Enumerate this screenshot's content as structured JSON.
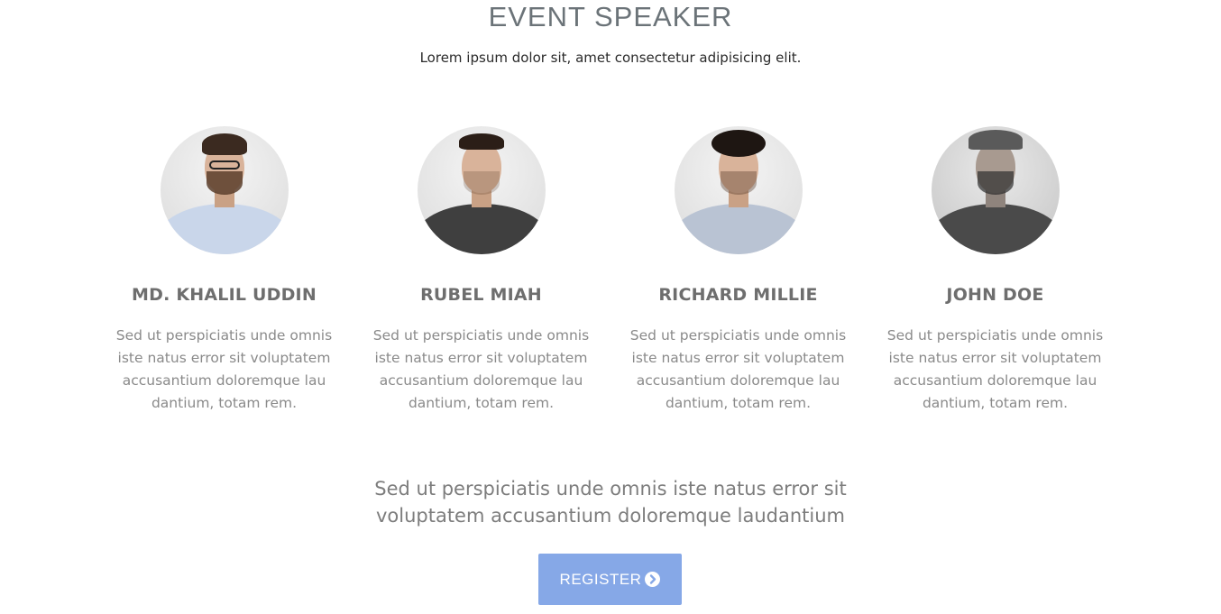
{
  "section": {
    "title": "EVENT SPEAKER",
    "subtitle": "Lorem ipsum dolor sit, amet consectetur adipisicing elit."
  },
  "speakers": [
    {
      "name": "MD. KHALIL UDDIN",
      "bio": "Sed ut perspiciatis unde omnis iste natus error sit voluptatem accusantium doloremque lau dantium, totam rem."
    },
    {
      "name": "RUBEL MIAH",
      "bio": "Sed ut perspiciatis unde omnis iste natus error sit voluptatem accusantium doloremque lau dantium, totam rem."
    },
    {
      "name": "RICHARD MILLIE",
      "bio": "Sed ut perspiciatis unde omnis iste natus error sit voluptatem accusantium doloremque lau dantium, totam rem."
    },
    {
      "name": "JOHN DOE",
      "bio": "Sed ut perspiciatis unde omnis iste natus error sit voluptatem accusantium doloremque lau dantium, totam rem."
    }
  ],
  "cta": {
    "text": "Sed ut perspiciatis unde omnis iste natus error sit voluptatem accusantium doloremque laudantium",
    "button_label": "REGISTER",
    "button_icon": "chevron-circle-right-icon",
    "button_color": "#86a8e7"
  }
}
